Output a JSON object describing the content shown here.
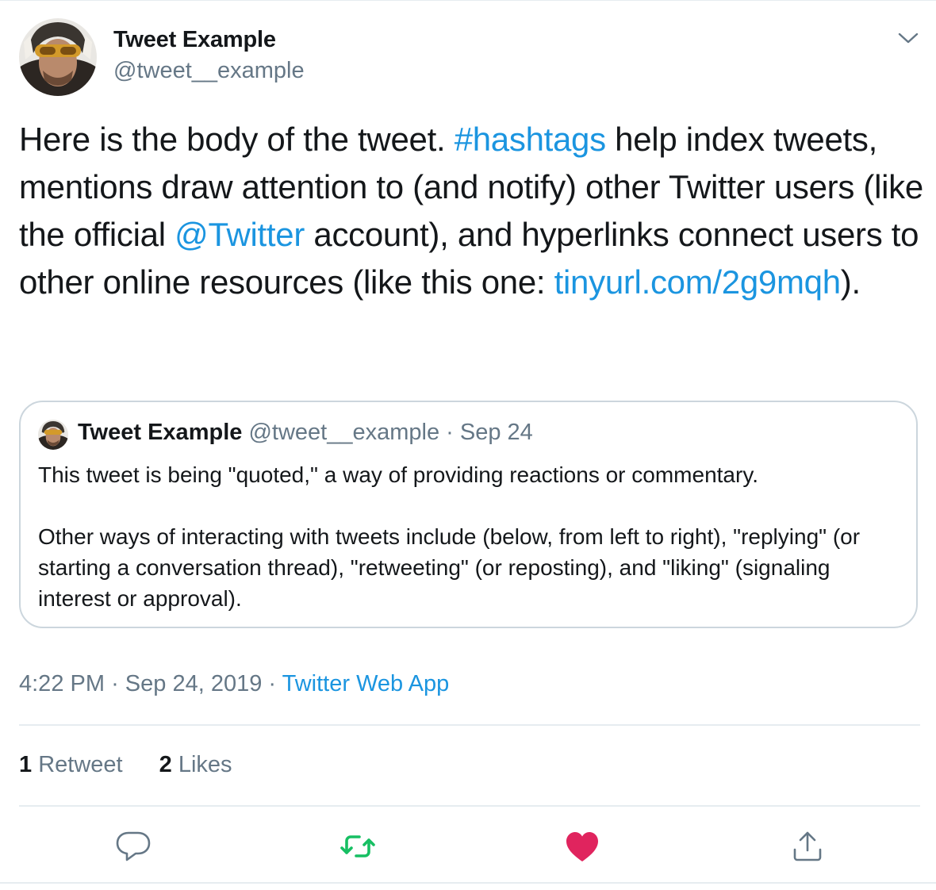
{
  "tweet": {
    "author_name": "Tweet Example",
    "author_handle": "@tweet__example",
    "body": [
      {
        "text": "Here is the body of the tweet. ",
        "type": "text"
      },
      {
        "text": "#hashtags",
        "type": "link"
      },
      {
        "text": " help index tweets, mentions draw attention to (and notify) other Twitter users (like the official ",
        "type": "text"
      },
      {
        "text": "@Twitter",
        "type": "link"
      },
      {
        "text": " account), and hyperlinks connect users to other online resources (like this one: ",
        "type": "text"
      },
      {
        "text": "tinyurl.com/2g9mqh",
        "type": "link"
      },
      {
        "text": ").",
        "type": "text"
      }
    ],
    "time": "4:22 PM",
    "date": "Sep 24, 2019",
    "source": "Twitter Web App",
    "separator": "·",
    "retweet_count": "1",
    "retweet_label": "Retweet",
    "like_count": "2",
    "like_label": "Likes"
  },
  "quoted": {
    "author_name": "Tweet Example",
    "author_handle": "@tweet__example",
    "separator": "·",
    "date": "Sep 24",
    "paragraph_1": "This tweet is being \"quoted,\" a way of providing reactions or commentary.",
    "paragraph_2": "Other ways of interacting with tweets include (below, from left to right), \"replying\" (or starting a conversation thread), \"retweeting\" (or reposting), and \"liking\" (signaling interest or approval)."
  },
  "actions": [
    {
      "name": "reply",
      "icon": "reply-icon",
      "color": "#657786"
    },
    {
      "name": "retweet",
      "icon": "retweet-icon",
      "color": "#17bf63"
    },
    {
      "name": "like",
      "icon": "heart-icon",
      "color": "#e0245e"
    },
    {
      "name": "share",
      "icon": "share-icon",
      "color": "#657786"
    }
  ],
  "colors": {
    "link": "#1b95e0",
    "secondary_text": "#657786",
    "primary_text": "#14171a",
    "border": "#ccd6dd",
    "divider": "#e6ecf0",
    "retweeted": "#17bf63",
    "liked": "#e0245e"
  }
}
